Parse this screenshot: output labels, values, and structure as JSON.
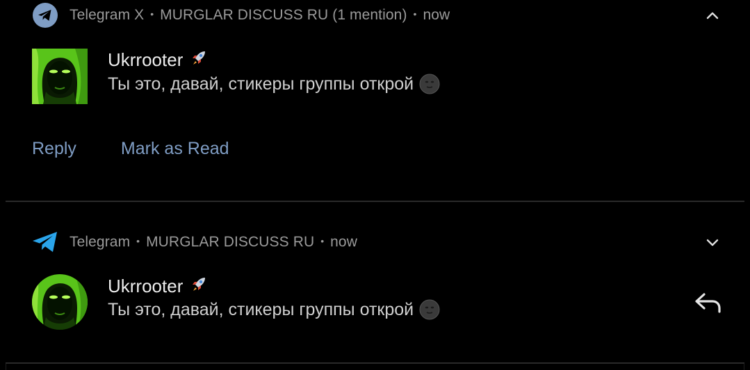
{
  "notifications": [
    {
      "app_name": "Telegram X",
      "group": "MURGLAR DISCUSS RU (1 mention)",
      "time": "now",
      "sender": "Ukrrooter",
      "message": "Ты это, давай, стикеры группы открой",
      "actions": [
        "Reply",
        "Mark as Read"
      ],
      "expanded": true,
      "app_icon": "telegram-x-icon"
    },
    {
      "app_name": "Telegram",
      "group": "MURGLAR DISCUSS RU",
      "time": "now",
      "sender": "Ukrrooter",
      "message": "Ты это, давай, стикеры группы открой",
      "expanded": false,
      "app_icon": "telegram-icon"
    }
  ],
  "colors": {
    "background": "#000000",
    "action_text": "#7f9dc4",
    "telegram_x_icon": "#7f9dc4",
    "telegram_icon": "#2aa4ea",
    "secondary_text": "#9a9a9a"
  }
}
